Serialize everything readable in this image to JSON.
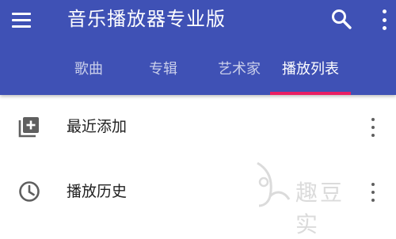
{
  "appbar": {
    "title": "音乐播放器专业版",
    "background_color": "#3f51b5",
    "icons": {
      "menu": "menu-icon",
      "search": "search-icon",
      "more": "more-vert-icon"
    }
  },
  "tabs": [
    {
      "label": "歌曲",
      "active": false
    },
    {
      "label": "专辑",
      "active": false
    },
    {
      "label": "艺术家",
      "active": false
    },
    {
      "label": "播放列表",
      "active": true
    }
  ],
  "tab_indicator_color": "#e91e63",
  "playlists": [
    {
      "label": "最近添加",
      "icon": "playlist-add-icon"
    },
    {
      "label": "播放历史",
      "icon": "history-clock-icon"
    }
  ],
  "watermark": {
    "text": "趣豆实"
  }
}
